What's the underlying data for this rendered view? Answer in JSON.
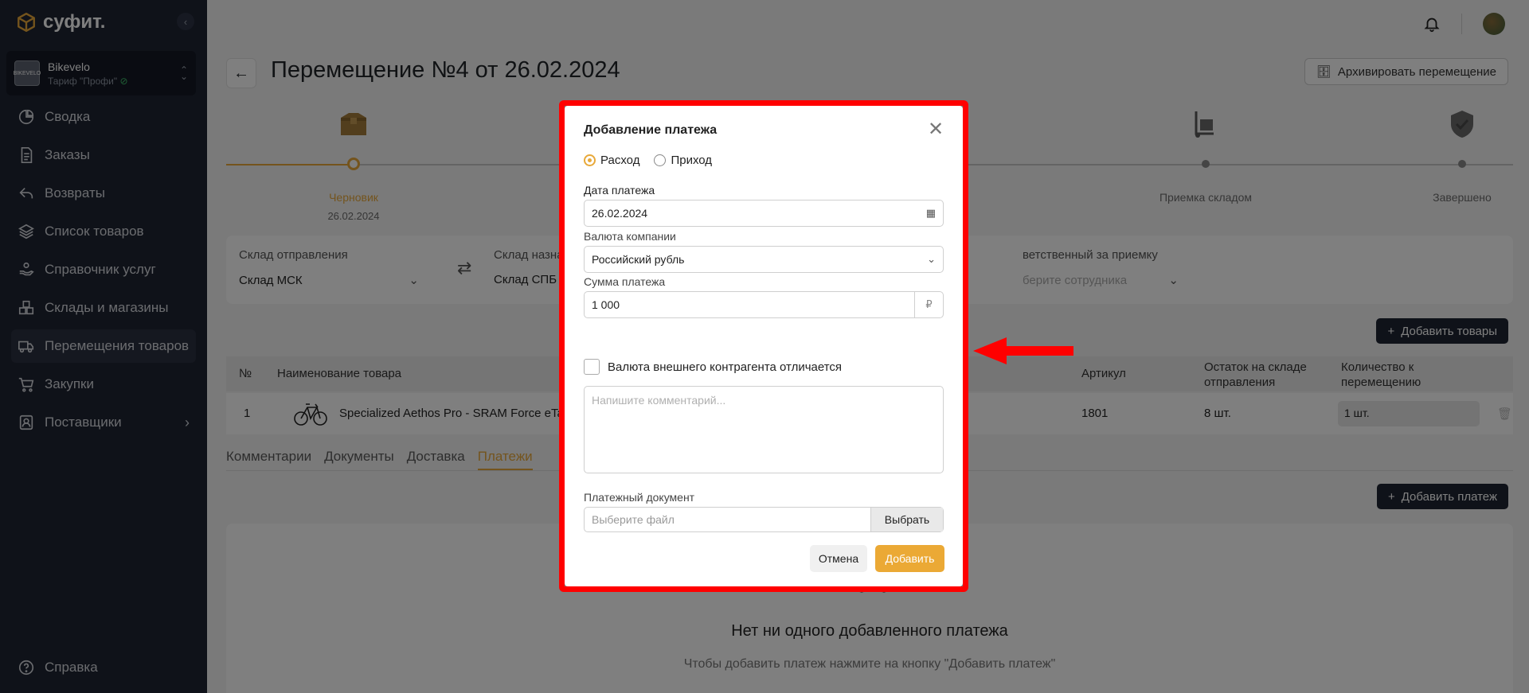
{
  "app": {
    "logo": "суфит."
  },
  "account": {
    "name": "Bikevelo",
    "plan": "Тариф \"Профи\"",
    "avatar_text": "BIKEVELO"
  },
  "sidebar": {
    "items": [
      {
        "label": "Сводка",
        "icon": "pie-chart-icon"
      },
      {
        "label": "Заказы",
        "icon": "document-icon"
      },
      {
        "label": "Возвраты",
        "icon": "return-icon"
      },
      {
        "label": "Список товаров",
        "icon": "layers-icon"
      },
      {
        "label": "Справочник услуг",
        "icon": "service-hand-icon"
      },
      {
        "label": "Склады и магазины",
        "icon": "boxes-icon"
      },
      {
        "label": "Перемещения товаров",
        "icon": "truck-icon",
        "active": true
      },
      {
        "label": "Закупки",
        "icon": "cart-icon"
      },
      {
        "label": "Поставщики",
        "icon": "contacts-icon",
        "has_submenu": true
      }
    ],
    "help": "Справка"
  },
  "header": {
    "title": "Перемещение №4 от 26.02.2024",
    "archive_button": "Архивировать перемещение"
  },
  "stepper": {
    "steps": [
      {
        "label": "Черновик",
        "date": "26.02.2024",
        "current": true
      },
      {
        "label": "Приемка складом"
      },
      {
        "label": "Завершено"
      }
    ]
  },
  "warehouses": {
    "from_label": "Склад отправления",
    "from_value": "Склад МСК",
    "to_label": "Склад назна",
    "to_value": "Склад СПБ",
    "responsible_label": "ветственный за приемку",
    "responsible_placeholder": "берите сотрудника"
  },
  "goods": {
    "add_button": "Добавить товары",
    "columns": {
      "num": "№",
      "name": "Наименование товара",
      "sku": "Артикул",
      "stock": "Остаток на складе отправления",
      "qty": "Количество к перемещению"
    },
    "rows": [
      {
        "num": "1",
        "name": "Specialized Aethos Pro - SRAM Force eTap AXS",
        "sku": "1801",
        "stock": "8 шт.",
        "qty": "1 шт."
      }
    ]
  },
  "tabs": [
    {
      "label": "Комментарии"
    },
    {
      "label": "Документы"
    },
    {
      "label": "Доставка"
    },
    {
      "label": "Платежи",
      "active": true
    }
  ],
  "payments": {
    "add_button": "Добавить платеж",
    "empty_title": "Нет ни одного добавленного платежа",
    "empty_subtitle": "Чтобы добавить платеж нажмите на кнопку \"Добавить платеж\""
  },
  "modal": {
    "title": "Добавление платежа",
    "radio_expense": "Расход",
    "radio_income": "Приход",
    "selected": "Расход",
    "date_label": "Дата платежа",
    "date_value": "26.02.2024",
    "currency_label": "Валюта компании",
    "currency_value": "Российский рубль",
    "amount_label": "Сумма платежа",
    "amount_value": "1 000",
    "amount_suffix": "₽",
    "checkbox_label": "Валюта внешнего контрагента отличается",
    "checkbox_checked": false,
    "comment_placeholder": "Напишите комментарий...",
    "document_label": "Платежный документ",
    "file_placeholder": "Выберите файл",
    "file_button": "Выбрать",
    "cancel_button": "Отмена",
    "submit_button": "Добавить"
  },
  "colors": {
    "accent": "#e8a93a",
    "sidebar_bg": "#1e2432",
    "highlight": "#ff0000"
  }
}
